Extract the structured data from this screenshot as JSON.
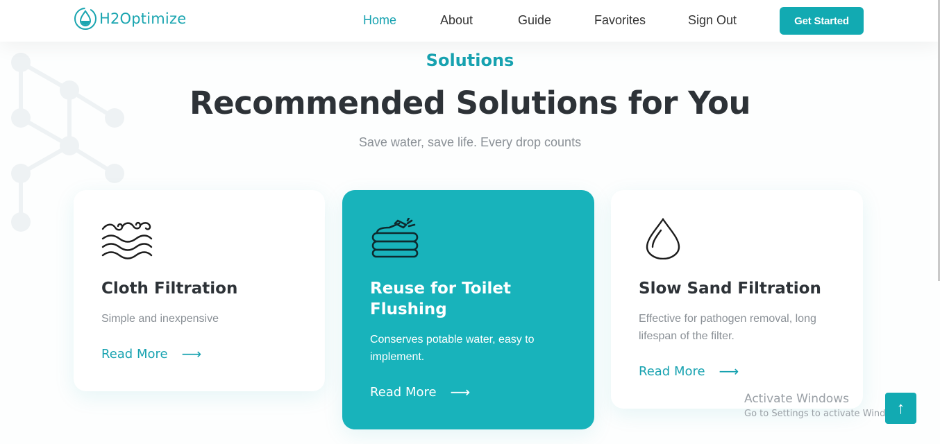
{
  "brand": {
    "name": "H2Optimize"
  },
  "nav": {
    "items": [
      {
        "label": "Home",
        "active": true
      },
      {
        "label": "About",
        "active": false
      },
      {
        "label": "Guide",
        "active": false
      },
      {
        "label": "Favorites",
        "active": false
      },
      {
        "label": "Sign Out",
        "active": false
      }
    ],
    "cta": "Get Started"
  },
  "section": {
    "tag": "Solutions",
    "title": "Recommended Solutions for You",
    "subtitle": "Save water, save life. Every drop counts"
  },
  "cards": [
    {
      "icon": "waves-icon",
      "title": "Cloth Filtration",
      "description": "Simple and inexpensive",
      "link": "Read More",
      "featured": false
    },
    {
      "icon": "hose-icon",
      "title": "Reuse for Toilet Flushing",
      "description": "Conserves potable water, easy to implement.",
      "link": "Read More",
      "featured": true
    },
    {
      "icon": "water-drop-icon",
      "title": "Slow Sand Filtration",
      "description": "Effective for pathogen removal, long lifespan of the filter.",
      "link": "Read More",
      "featured": false
    }
  ],
  "watermark": {
    "title": "Activate Windows",
    "subtitle": "Go to Settings to activate Windows."
  },
  "colors": {
    "accent": "#12aab2",
    "featured_card": "#18b3bb",
    "text_dark": "#2d3237",
    "text_muted": "#8a9096"
  }
}
